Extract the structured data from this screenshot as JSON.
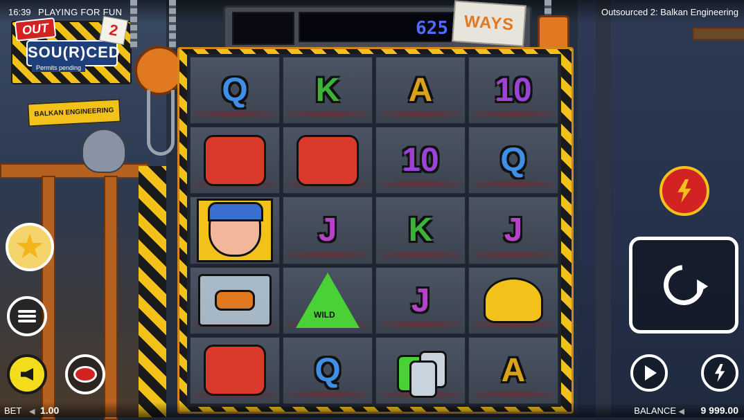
{
  "status": {
    "time": "16:39",
    "mode": "PLAYING FOR FUN",
    "game_title": "Outsourced 2: Balkan Engineering"
  },
  "logo": {
    "out": "OUT",
    "main": "SOU(R)CED",
    "sub": "Permits pending",
    "sequel": "2",
    "sign": "BALKAN ENGINEERING"
  },
  "ways": {
    "count": "625",
    "label": "WAYS"
  },
  "reels": [
    [
      {
        "type": "letter",
        "text": "Q",
        "color": "#3f8fe6"
      },
      {
        "type": "letter",
        "text": "K",
        "color": "#3bb33b"
      },
      {
        "type": "letter",
        "text": "A",
        "color": "#d9a21b"
      },
      {
        "type": "letter",
        "text": "10",
        "color": "#9a43d6"
      }
    ],
    [
      {
        "type": "icon",
        "text": "",
        "name": "gamepad",
        "color": "#d93a2b"
      },
      {
        "type": "icon",
        "text": "",
        "name": "gamepad",
        "color": "#d93a2b"
      },
      {
        "type": "letter",
        "text": "10",
        "color": "#9a43d6"
      },
      {
        "type": "letter",
        "text": "Q",
        "color": "#3f8fe6"
      }
    ],
    [
      {
        "type": "portrait",
        "text": "",
        "name": "engineer-portrait"
      },
      {
        "type": "letter",
        "text": "J",
        "color": "#b543c9"
      },
      {
        "type": "letter",
        "text": "K",
        "color": "#3bb33b"
      },
      {
        "type": "letter",
        "text": "J",
        "color": "#b543c9"
      }
    ],
    [
      {
        "type": "bag",
        "text": "",
        "name": "bagged-hand"
      },
      {
        "type": "wild",
        "text": "WILD",
        "color": "#4ad135"
      },
      {
        "type": "letter",
        "text": "J",
        "color": "#b543c9"
      },
      {
        "type": "helmet",
        "text": "",
        "name": "hard-hat"
      }
    ],
    [
      {
        "type": "icon",
        "text": "",
        "name": "gamepad",
        "color": "#d93a2b"
      },
      {
        "type": "letter",
        "text": "Q",
        "color": "#3f8fe6"
      },
      {
        "type": "cans",
        "text": "",
        "name": "crushed-cans"
      },
      {
        "type": "letter",
        "text": "A",
        "color": "#d9a21b"
      }
    ]
  ],
  "footer": {
    "bet_label": "BET",
    "bet_arrow": "◀",
    "bet_value": "1.00",
    "balance_label": "BALANCE",
    "balance_arrow": "◀",
    "balance_value": "9 999.00"
  },
  "icons": {
    "favorites": "star-icon",
    "menu": "menu-icon",
    "sound": "speaker-icon",
    "bet": "coin-icon",
    "feature": "lightning-icon",
    "spin": "spin-icon",
    "autoplay": "play-icon",
    "turbo": "turbo-icon"
  },
  "colors": {
    "hazard_yellow": "#f2c21b",
    "accent_red": "#d32222",
    "ways_blue": "#4e6cff"
  }
}
